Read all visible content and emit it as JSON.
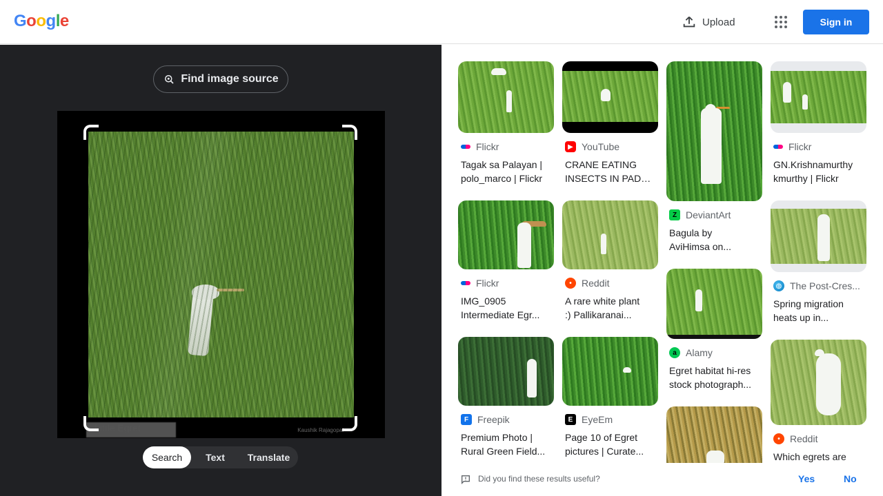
{
  "header": {
    "logo": [
      "G",
      "o",
      "o",
      "g",
      "l",
      "e"
    ],
    "logo_colors": [
      "#4285F4",
      "#EA4335",
      "#FBBC05",
      "#4285F4",
      "#34A853",
      "#EA4335"
    ],
    "upload_label": "Upload",
    "signin_label": "Sign in"
  },
  "left": {
    "find_source_label": "Find image source",
    "image_caption_left": "Little Egret",
    "image_caption_right": "Kaushik Rajagopal",
    "modes": [
      "Search",
      "Text",
      "Translate"
    ],
    "active_mode": "Search"
  },
  "results": [
    {
      "source": "Flickr",
      "icon": "flickr-icon",
      "title1": "Tagak sa Palayan |",
      "title2": "polo_marco | Flickr"
    },
    {
      "source": "YouTube",
      "icon": "youtube-icon",
      "title1": "CRANE EATING",
      "title2": "INSECTS IN PADD..."
    },
    {
      "source": "DeviantArt",
      "icon": "deviantart-icon",
      "title1": "Bagula by",
      "title2": "AviHimsa on..."
    },
    {
      "source": "Flickr",
      "icon": "flickr-icon",
      "title1": "GN.Krishnamurthy",
      "title2": "kmurthy | Flickr"
    },
    {
      "source": "Flickr",
      "icon": "flickr-icon",
      "title1": "IMG_0905",
      "title2": "Intermediate Egr..."
    },
    {
      "source": "Reddit",
      "icon": "reddit-icon",
      "title1": "A rare white plant",
      "title2": ":) Pallikaranai..."
    },
    {
      "source": "Alamy",
      "icon": "alamy-icon",
      "title1": "Egret habitat hi-res",
      "title2": "stock photograph..."
    },
    {
      "source": "The Post-Cres...",
      "icon": "globe-icon",
      "title1": "Spring migration",
      "title2": "heats up in..."
    },
    {
      "source": "Freepik",
      "icon": "freepik-icon",
      "title1": "Premium Photo |",
      "title2": "Rural Green Field..."
    },
    {
      "source": "EyeEm",
      "icon": "eyeem-icon",
      "title1": "Page 10 of Egret",
      "title2": "pictures | Curate..."
    },
    {
      "source": "Reddit",
      "icon": "reddit-icon",
      "title1": "Which egrets are",
      "title2": ""
    }
  ],
  "feedback": {
    "question": "Did you find these results useful?",
    "yes": "Yes",
    "no": "No"
  },
  "colors": {
    "accent": "#1a73e8",
    "left_pane": "#202124"
  }
}
